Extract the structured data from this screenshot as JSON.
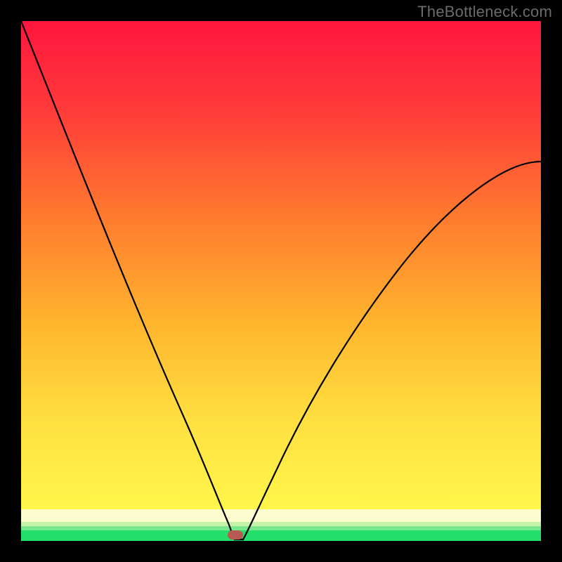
{
  "watermark": "TheBottleneck.com",
  "chart_data": {
    "type": "line",
    "title": "",
    "xlabel": "",
    "ylabel": "",
    "xlim": [
      0,
      100
    ],
    "ylim": [
      0,
      100
    ],
    "grid": false,
    "legend": false,
    "series": [
      {
        "name": "bottleneck-curve",
        "x": [
          0,
          5,
          10,
          15,
          20,
          25,
          30,
          35,
          38,
          40,
          41,
          42,
          45,
          50,
          55,
          60,
          65,
          70,
          75,
          80,
          85,
          90,
          95,
          100
        ],
        "y": [
          100,
          89,
          78,
          67,
          56,
          45,
          33,
          20,
          11,
          4,
          0,
          0,
          4,
          12,
          20,
          28,
          36,
          43,
          50,
          56,
          61,
          66,
          70,
          73
        ]
      }
    ],
    "bands": [
      {
        "name": "gradient-top",
        "y0": 6,
        "y1": 100,
        "color_top": "#ff1a3f",
        "color_bottom": "#ffe640"
      },
      {
        "name": "band-paleyellow",
        "y0": 3.5,
        "y1": 6,
        "color": "#fdfccf"
      },
      {
        "name": "band-palegreen",
        "y0": 2.0,
        "y1": 3.5,
        "color": "#c7f3a8"
      },
      {
        "name": "band-green",
        "y0": 0,
        "y1": 2.0,
        "color": "#2de56f"
      }
    ],
    "marker": {
      "x": 41.5,
      "y": 0.5,
      "color": "#b85a53"
    }
  }
}
